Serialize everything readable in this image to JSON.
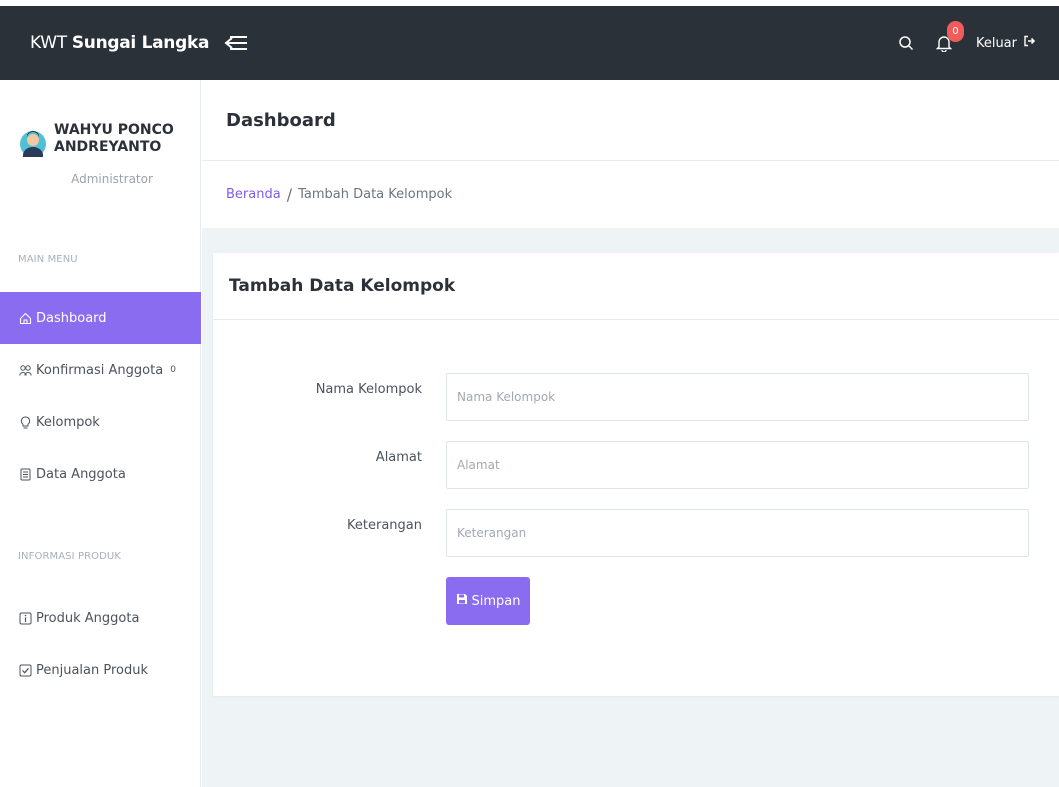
{
  "topbar": {
    "brand_thin": "KWT",
    "brand_bold": "Sungai Langka",
    "notification_count": "0",
    "logout_label": "Keluar"
  },
  "sidebar": {
    "profile_name": "WAHYU PONCO ANDREYANTO",
    "profile_role": "Administrator",
    "section_main": "MAIN MENU",
    "section_info": "INFORMASI PRODUK",
    "items": [
      {
        "label": "Dashboard",
        "icon": "home-icon",
        "active": true
      },
      {
        "label": "Konfirmasi Anggota",
        "icon": "users-icon",
        "count": "0"
      },
      {
        "label": "Kelompok",
        "icon": "bulb-icon"
      },
      {
        "label": "Data Anggota",
        "icon": "list-icon"
      },
      {
        "label": "Produk Anggota",
        "icon": "info-icon"
      },
      {
        "label": "Penjualan Produk",
        "icon": "check-icon"
      }
    ]
  },
  "main": {
    "page_title": "Dashboard",
    "breadcrumb": {
      "home": "Beranda",
      "separator": "/",
      "current": "Tambah Data Kelompok"
    },
    "card_title": "Tambah Data Kelompok",
    "form": {
      "fields": [
        {
          "label": "Nama Kelompok",
          "placeholder": "Nama Kelompok",
          "value": ""
        },
        {
          "label": "Alamat",
          "placeholder": "Alamat",
          "value": ""
        },
        {
          "label": "Keterangan",
          "placeholder": "Keterangan",
          "value": ""
        }
      ],
      "save_label": "Simpan"
    }
  },
  "colors": {
    "topbar": "#2b3138",
    "accent": "#8a6cf0",
    "badge": "#f15b5b",
    "content_bg": "#eef3f6"
  }
}
